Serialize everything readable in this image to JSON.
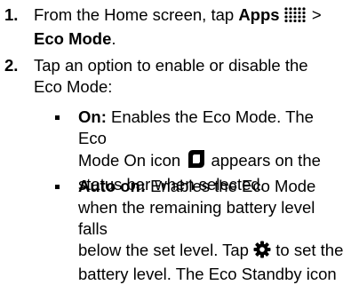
{
  "steps": [
    {
      "number": "1.",
      "text_before": "From the Home screen, tap ",
      "apps_label": "Apps",
      "text_after_icon": " >",
      "eco_mode_label": "Eco Mode",
      "end_period": "."
    },
    {
      "number": "2.",
      "line1": "Tap an option to enable or disable the",
      "line2": "Eco Mode:"
    }
  ],
  "options": [
    {
      "label": "On:",
      "text1": " Enables the Eco Mode. The Eco",
      "text2_before": "Mode On icon ",
      "text2_after": " appears on the",
      "text3": "status bar when selected."
    },
    {
      "label": "Auto on:",
      "text1": " Enables the Eco Mode",
      "text2": "when the remaining battery level falls",
      "text3_before": "below the set level. Tap ",
      "text3_after": " to set the",
      "text4": "battery level. The Eco Standby icon"
    }
  ],
  "icons": {
    "apps": "apps-grid-icon",
    "eco_mode_on": "eco-mode-on-icon",
    "settings": "gear-icon"
  }
}
